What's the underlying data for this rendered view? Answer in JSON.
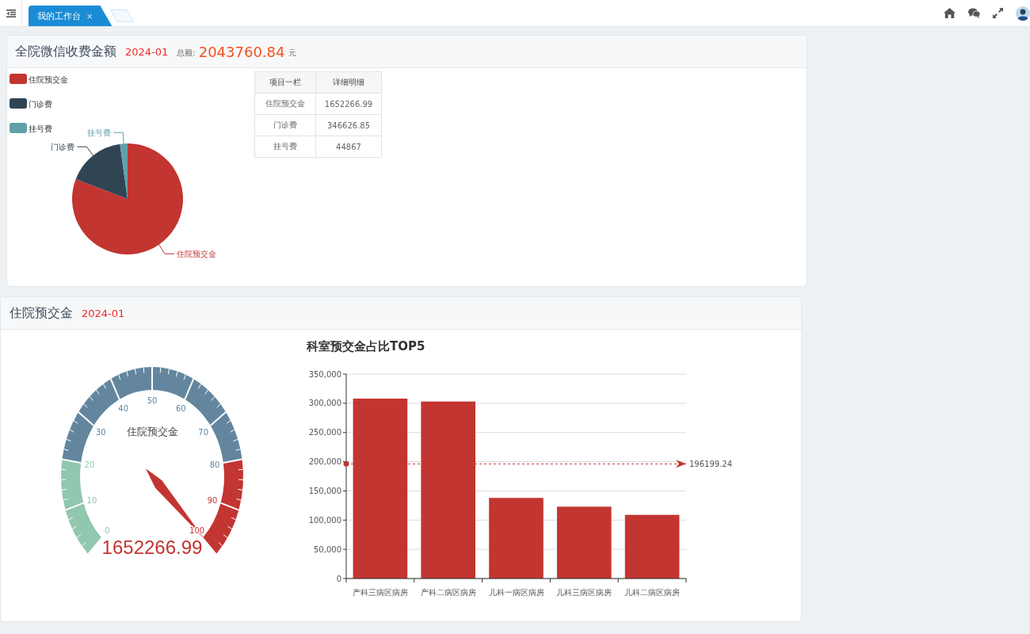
{
  "topbar": {
    "tabs": [
      {
        "label": "我的工作台",
        "close": "×",
        "selected": true
      }
    ]
  },
  "fee_panel": {
    "title": "全院微信收费金额",
    "period": "2024-01",
    "total_label": "总额:",
    "total": "2043760.84",
    "unit": "元",
    "legend": [
      {
        "label": "住院预交金",
        "color": "#c23531"
      },
      {
        "label": "门诊费",
        "color": "#2f4554"
      },
      {
        "label": "挂号费",
        "color": "#61a0a8"
      }
    ],
    "chart_data": {
      "type": "pie",
      "categories": [
        "住院预交金",
        "门诊费",
        "挂号费"
      ],
      "values": [
        80.84,
        16.96,
        2.2
      ]
    },
    "table": {
      "columns": [
        "项目一栏",
        "详细明细"
      ],
      "rows": [
        [
          "住院预交金",
          "1652266.99"
        ],
        [
          "门诊费",
          "346626.85"
        ],
        [
          "挂号费",
          "44867"
        ]
      ]
    }
  },
  "deposit_panel": {
    "title": "住院预交金",
    "period": "2024-01",
    "gauge": {
      "title": "住院预交金",
      "value": "1652266.99",
      "level": 1,
      "bands": [
        {
          "color": "#91c7ae",
          "ticks": [
            "0",
            "10",
            "20"
          ]
        },
        {
          "color": "#63869e",
          "ticks": [
            "30",
            "40",
            "50",
            "60",
            "70",
            "80"
          ]
        },
        {
          "color": "#c23531",
          "ticks": [
            "90",
            "100"
          ]
        }
      ]
    },
    "chart_data": {
      "type": "bar",
      "title": "科室预交金占比TOP5",
      "categories": [
        "产科三病区病房",
        "产科二病区病房",
        "儿科一病区病房",
        "儿科三病区病房",
        "儿科二病区病房"
      ],
      "series": [
        {
          "color": "#c23531",
          "values": [
            308000,
            303000,
            138000,
            123000,
            109000
          ]
        }
      ],
      "ylim": [
        0,
        350000
      ],
      "yticks": [
        {
          "value": 0,
          "label": "0"
        },
        {
          "value": 50000,
          "label": "50,000"
        },
        {
          "value": 100000,
          "label": "100,000"
        },
        {
          "value": 150000,
          "label": "150,000"
        },
        {
          "value": 200000,
          "label": "200,000"
        },
        {
          "value": 250000,
          "label": "250,000"
        },
        {
          "value": 300000,
          "label": "300,000"
        },
        {
          "value": 350000,
          "label": "350,000"
        }
      ],
      "grid": true,
      "ref_lines": [
        {
          "axis": "y",
          "value": 196199.24,
          "label": "196199.24"
        }
      ]
    }
  }
}
